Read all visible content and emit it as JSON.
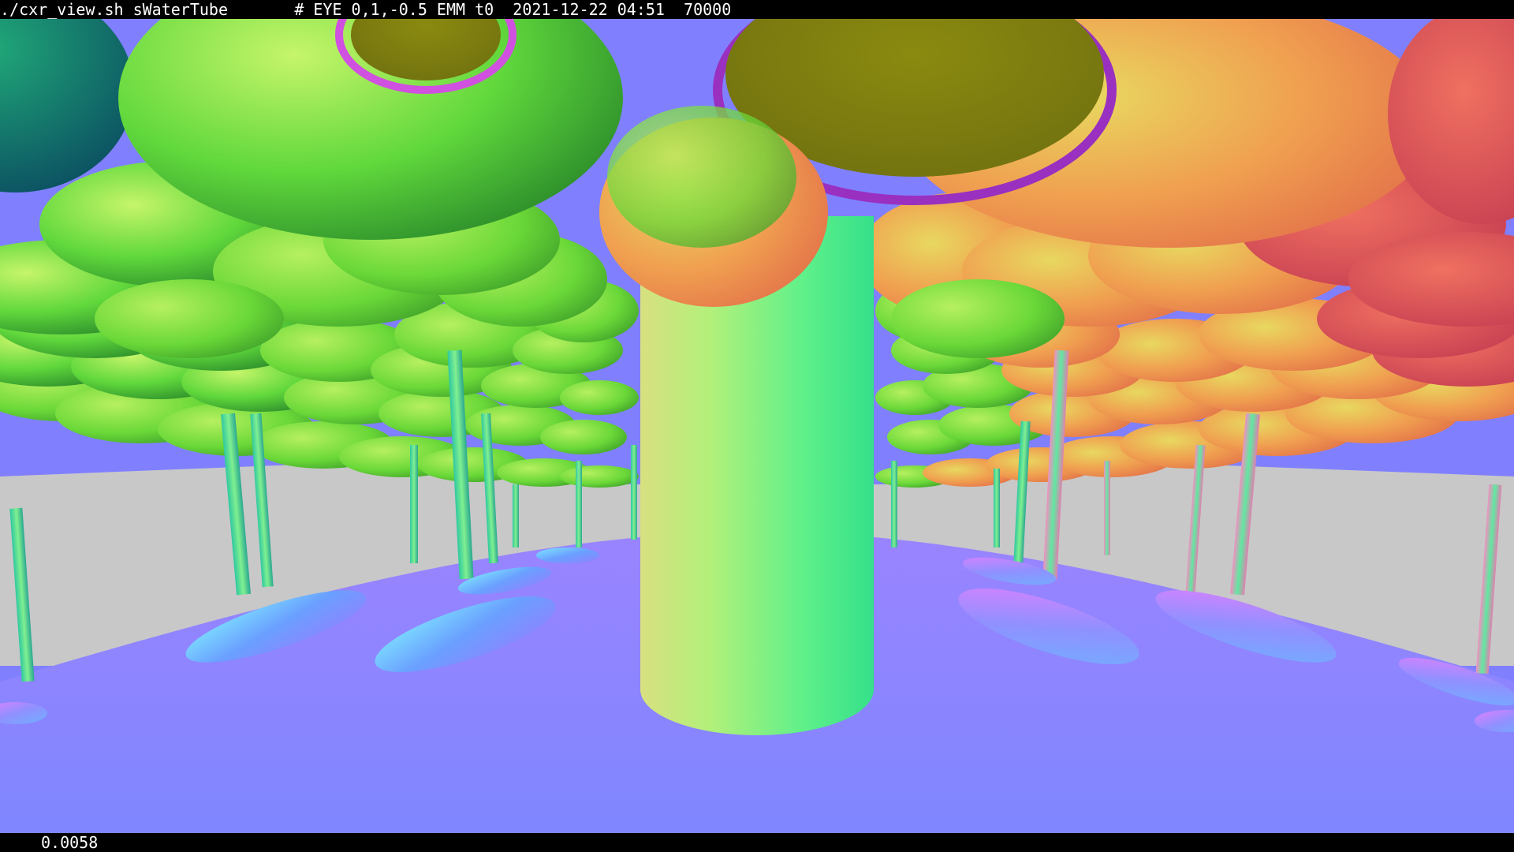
{
  "top_bar": {
    "script": "./cxr_view.sh",
    "geometry": "sWaterTube",
    "eye": "# EYE 0,1,-0.5 EMM t0",
    "timestamp": "2021-12-22 04:51",
    "count": "70000"
  },
  "bottom_bar": {
    "frame_time": "0.0058"
  },
  "scene": {
    "description_icon": "normal-shaded-3d-render",
    "colors": {
      "sky": "#8080ff",
      "horizon_gray": "#c8c8c8",
      "floor_start": "#9a84ff",
      "floor_end": "#7f86ff",
      "cap_green": "#6fe84a",
      "cap_yellow": "#c9e84a",
      "cap_orange": "#f0a050",
      "cap_red": "#f05060",
      "cap_teal": "#1aa870",
      "stem_green": "#60e890",
      "dish_blue": "#6aa0ff"
    }
  }
}
